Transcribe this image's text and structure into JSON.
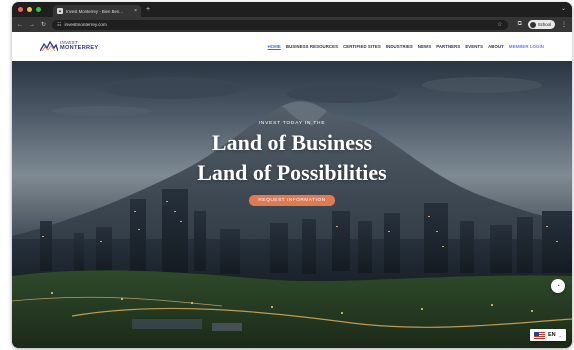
{
  "browser": {
    "tab_title": "Invest Monterrey - Bien Ben...",
    "tab_close": "×",
    "new_tab": "+",
    "url": "investmonterrey.com",
    "profile_name": "School",
    "traffic_colors": [
      "#ff5f57",
      "#febc2e",
      "#28c840"
    ]
  },
  "site": {
    "logo_line1": "INVEST",
    "logo_line2": "MONTERREY",
    "menu": [
      {
        "label": "HOME",
        "state": "active"
      },
      {
        "label": "BUSINESS RESOURCES",
        "state": "normal"
      },
      {
        "label": "CERTIFIED SITES",
        "state": "normal"
      },
      {
        "label": "INDUSTRIES",
        "state": "normal"
      },
      {
        "label": "NEWS",
        "state": "normal"
      },
      {
        "label": "PARTNERS",
        "state": "normal"
      },
      {
        "label": "EVENTS",
        "state": "normal"
      },
      {
        "label": "ABOUT",
        "state": "normal"
      },
      {
        "label": "MEMBER LOGIN",
        "state": "highlight"
      }
    ]
  },
  "hero": {
    "eyebrow": "INVEST TODAY IN THE",
    "headline_line1": "Land of Business",
    "headline_line2": "Land of Possibilities",
    "cta": "REQUEST INFORMATION"
  },
  "language": {
    "code": "EN",
    "caret": "⌄"
  },
  "colors": {
    "accent": "#e07a52",
    "brand": "#2a3a8c",
    "menu_active": "#3a6ad8",
    "menu_login": "#6a78ff"
  },
  "icons": {
    "back": "back-icon",
    "forward": "forward-icon",
    "reload": "reload-icon",
    "site_settings": "tune-icon",
    "bookmark": "star-icon",
    "extensions": "extension-icon",
    "chat": "chat-icon",
    "flag": "us-flag-icon"
  }
}
